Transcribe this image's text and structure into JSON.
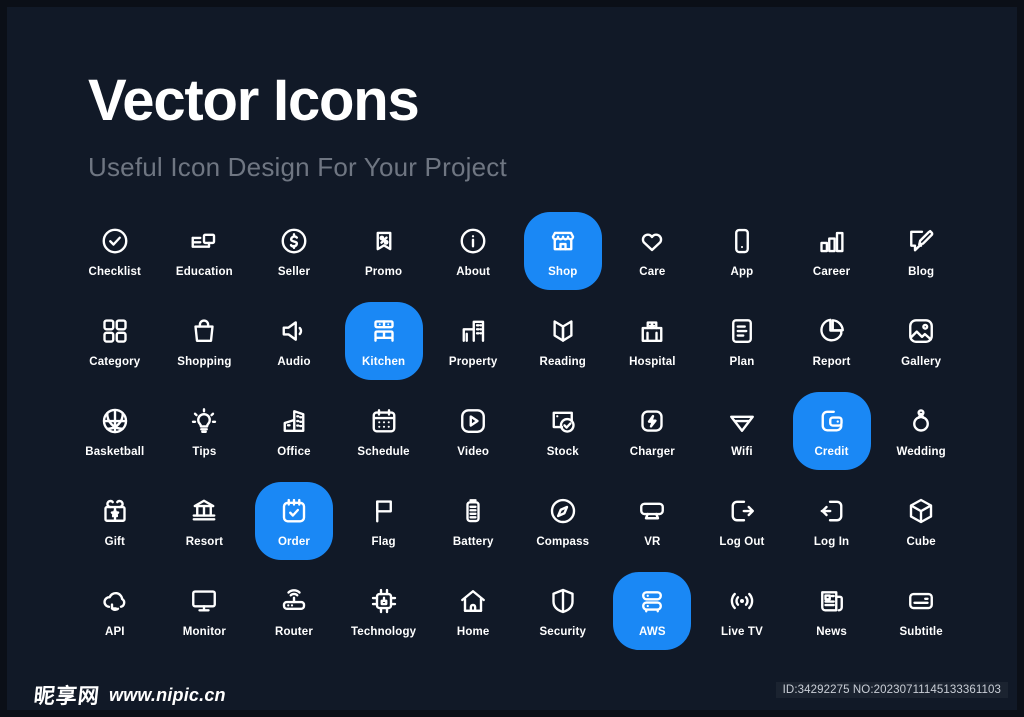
{
  "header": {
    "title": "Vector Icons",
    "subtitle": "Useful Icon Design For Your Project"
  },
  "colors": {
    "background": "#111927",
    "frame": "#0b0f17",
    "accent": "#1a88f5",
    "label": "#ffffff",
    "subtitle": "#6f7682"
  },
  "icons": [
    {
      "label": "Checklist",
      "icon": "check-circle-icon",
      "highlighted": false
    },
    {
      "label": "Education",
      "icon": "education-icon",
      "highlighted": false
    },
    {
      "label": "Seller",
      "icon": "dollar-circle-icon",
      "highlighted": false
    },
    {
      "label": "Promo",
      "icon": "promo-tag-icon",
      "highlighted": false
    },
    {
      "label": "About",
      "icon": "info-circle-icon",
      "highlighted": false
    },
    {
      "label": "Shop",
      "icon": "storefront-icon",
      "highlighted": true
    },
    {
      "label": "Care",
      "icon": "heart-icon",
      "highlighted": false
    },
    {
      "label": "App",
      "icon": "phone-icon",
      "highlighted": false
    },
    {
      "label": "Career",
      "icon": "bar-chart-icon",
      "highlighted": false
    },
    {
      "label": "Blog",
      "icon": "blog-pencil-icon",
      "highlighted": false
    },
    {
      "label": "Category",
      "icon": "grid-squares-icon",
      "highlighted": false
    },
    {
      "label": "Shopping",
      "icon": "shopping-bag-icon",
      "highlighted": false
    },
    {
      "label": "Audio",
      "icon": "speaker-icon",
      "highlighted": false
    },
    {
      "label": "Kitchen",
      "icon": "kitchen-counter-icon",
      "highlighted": true
    },
    {
      "label": "Property",
      "icon": "buildings-icon",
      "highlighted": false
    },
    {
      "label": "Reading",
      "icon": "open-book-icon",
      "highlighted": false
    },
    {
      "label": "Hospital",
      "icon": "hospital-icon",
      "highlighted": false
    },
    {
      "label": "Plan",
      "icon": "document-lines-icon",
      "highlighted": false
    },
    {
      "label": "Report",
      "icon": "pie-chart-icon",
      "highlighted": false
    },
    {
      "label": "Gallery",
      "icon": "image-icon",
      "highlighted": false
    },
    {
      "label": "Basketball",
      "icon": "basketball-icon",
      "highlighted": false
    },
    {
      "label": "Tips",
      "icon": "lightbulb-icon",
      "highlighted": false
    },
    {
      "label": "Office",
      "icon": "office-building-icon",
      "highlighted": false
    },
    {
      "label": "Schedule",
      "icon": "calendar-dots-icon",
      "highlighted": false
    },
    {
      "label": "Video",
      "icon": "play-square-icon",
      "highlighted": false
    },
    {
      "label": "Stock",
      "icon": "stock-check-icon",
      "highlighted": false
    },
    {
      "label": "Charger",
      "icon": "bolt-square-icon",
      "highlighted": false
    },
    {
      "label": "Wifi",
      "icon": "wifi-icon",
      "highlighted": false
    },
    {
      "label": "Credit",
      "icon": "wallet-card-icon",
      "highlighted": true
    },
    {
      "label": "Wedding",
      "icon": "ring-icon",
      "highlighted": false
    },
    {
      "label": "Gift",
      "icon": "gift-box-icon",
      "highlighted": false
    },
    {
      "label": "Resort",
      "icon": "resort-house-icon",
      "highlighted": false
    },
    {
      "label": "Order",
      "icon": "calendar-check-icon",
      "highlighted": true
    },
    {
      "label": "Flag",
      "icon": "flag-icon",
      "highlighted": false
    },
    {
      "label": "Battery",
      "icon": "battery-icon",
      "highlighted": false
    },
    {
      "label": "Compass",
      "icon": "compass-icon",
      "highlighted": false
    },
    {
      "label": "VR",
      "icon": "vr-monitor-icon",
      "highlighted": false
    },
    {
      "label": "Log Out",
      "icon": "logout-arrow-icon",
      "highlighted": false
    },
    {
      "label": "Log In",
      "icon": "login-arrow-icon",
      "highlighted": false
    },
    {
      "label": "Cube",
      "icon": "cube-icon",
      "highlighted": false
    },
    {
      "label": "API",
      "icon": "cloud-sync-icon",
      "highlighted": false
    },
    {
      "label": "Monitor",
      "icon": "desktop-monitor-icon",
      "highlighted": false
    },
    {
      "label": "Router",
      "icon": "router-icon",
      "highlighted": false
    },
    {
      "label": "Technology",
      "icon": "chip-icon",
      "highlighted": false
    },
    {
      "label": "Home",
      "icon": "home-icon",
      "highlighted": false
    },
    {
      "label": "Security",
      "icon": "shield-icon",
      "highlighted": false
    },
    {
      "label": "AWS",
      "icon": "server-stack-icon",
      "highlighted": true
    },
    {
      "label": "Live TV",
      "icon": "broadcast-icon",
      "highlighted": false
    },
    {
      "label": "News",
      "icon": "newspaper-icon",
      "highlighted": false
    },
    {
      "label": "Subtitle",
      "icon": "subtitle-box-icon",
      "highlighted": false
    }
  ],
  "footer": {
    "brand_cn": "昵享网",
    "brand_url": "www.nipic.cn",
    "id_text": "ID:34292275 NO:20230711145133361103"
  }
}
